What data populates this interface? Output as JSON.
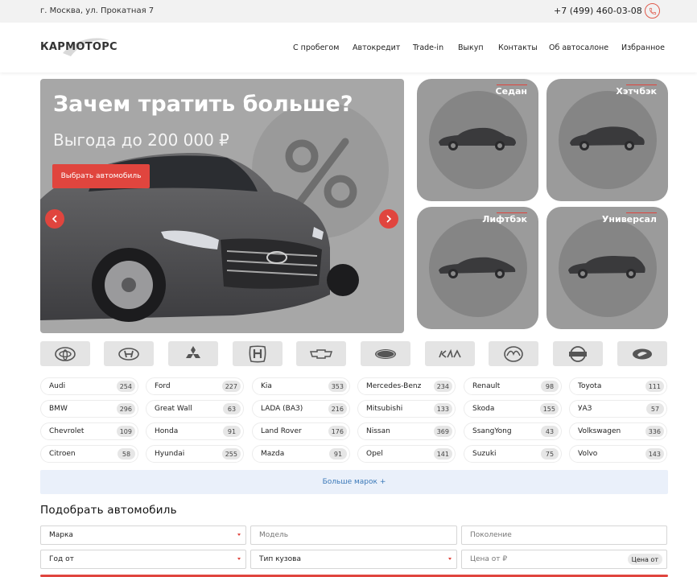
{
  "topbar": {
    "address": "г. Москва, ул. Прокатная 7",
    "phone": "+7 (499) 460-03-08"
  },
  "header": {
    "logo_text": "КАРМОТОРС",
    "nav": [
      "С пробегом",
      "Автокредит",
      "Trade-in",
      "Выкуп",
      "Контакты",
      "Об автосалоне",
      "Избранное"
    ]
  },
  "hero": {
    "title": "Зачем тратить больше?",
    "subtitle": "Выгода до 200 000 ₽",
    "button": "Выбрать автомобиль"
  },
  "body_types": [
    "Седан",
    "Хэтчбэк",
    "Лифтбэк",
    "Универсал"
  ],
  "brand_logos": [
    "toyota-logo",
    "hyundai-logo",
    "mitsubishi-logo",
    "honda-logo",
    "chevrolet-logo",
    "ford-logo",
    "kia-logo",
    "mazda-logo",
    "nissan-logo",
    "lada-logo"
  ],
  "brands": [
    [
      {
        "name": "Audi",
        "count": "254"
      },
      {
        "name": "Ford",
        "count": "227"
      },
      {
        "name": "Kia",
        "count": "353"
      },
      {
        "name": "Mercedes-Benz",
        "count": "234"
      },
      {
        "name": "Renault",
        "count": "98"
      },
      {
        "name": "Toyota",
        "count": "111"
      }
    ],
    [
      {
        "name": "BMW",
        "count": "296"
      },
      {
        "name": "Great Wall",
        "count": "63"
      },
      {
        "name": "LADA (ВАЗ)",
        "count": "216"
      },
      {
        "name": "Mitsubishi",
        "count": "133"
      },
      {
        "name": "Skoda",
        "count": "155"
      },
      {
        "name": "УАЗ",
        "count": "57"
      }
    ],
    [
      {
        "name": "Chevrolet",
        "count": "109"
      },
      {
        "name": "Honda",
        "count": "91"
      },
      {
        "name": "Land Rover",
        "count": "176"
      },
      {
        "name": "Nissan",
        "count": "369"
      },
      {
        "name": "SsangYong",
        "count": "43"
      },
      {
        "name": "Volkswagen",
        "count": "336"
      }
    ],
    [
      {
        "name": "Citroen",
        "count": "58"
      },
      {
        "name": "Hyundai",
        "count": "255"
      },
      {
        "name": "Mazda",
        "count": "91"
      },
      {
        "name": "Opel",
        "count": "141"
      },
      {
        "name": "Suzuki",
        "count": "75"
      },
      {
        "name": "Volvo",
        "count": "143"
      }
    ]
  ],
  "more_brands": "Больше марок +",
  "filter": {
    "title": "Подобрать автомобиль",
    "make": "Марка",
    "model": "Модель",
    "generation": "Поколение",
    "year_from": "Год от",
    "body_type": "Тип кузова",
    "price_from": "Цена от ₽",
    "price_chip": "Цена от"
  },
  "colors": {
    "accent": "#e0453e",
    "link": "#3a78b8",
    "tile": "#9b9b9b"
  }
}
